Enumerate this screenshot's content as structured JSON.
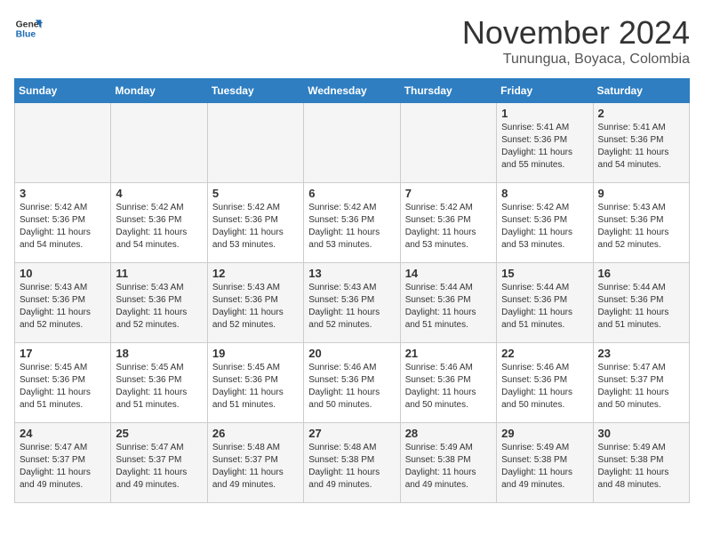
{
  "header": {
    "logo_general": "General",
    "logo_blue": "Blue",
    "month_title": "November 2024",
    "subtitle": "Tunungua, Boyaca, Colombia"
  },
  "days_of_week": [
    "Sunday",
    "Monday",
    "Tuesday",
    "Wednesday",
    "Thursday",
    "Friday",
    "Saturday"
  ],
  "weeks": [
    [
      {
        "day": "",
        "info": ""
      },
      {
        "day": "",
        "info": ""
      },
      {
        "day": "",
        "info": ""
      },
      {
        "day": "",
        "info": ""
      },
      {
        "day": "",
        "info": ""
      },
      {
        "day": "1",
        "info": "Sunrise: 5:41 AM\nSunset: 5:36 PM\nDaylight: 11 hours\nand 55 minutes."
      },
      {
        "day": "2",
        "info": "Sunrise: 5:41 AM\nSunset: 5:36 PM\nDaylight: 11 hours\nand 54 minutes."
      }
    ],
    [
      {
        "day": "3",
        "info": "Sunrise: 5:42 AM\nSunset: 5:36 PM\nDaylight: 11 hours\nand 54 minutes."
      },
      {
        "day": "4",
        "info": "Sunrise: 5:42 AM\nSunset: 5:36 PM\nDaylight: 11 hours\nand 54 minutes."
      },
      {
        "day": "5",
        "info": "Sunrise: 5:42 AM\nSunset: 5:36 PM\nDaylight: 11 hours\nand 53 minutes."
      },
      {
        "day": "6",
        "info": "Sunrise: 5:42 AM\nSunset: 5:36 PM\nDaylight: 11 hours\nand 53 minutes."
      },
      {
        "day": "7",
        "info": "Sunrise: 5:42 AM\nSunset: 5:36 PM\nDaylight: 11 hours\nand 53 minutes."
      },
      {
        "day": "8",
        "info": "Sunrise: 5:42 AM\nSunset: 5:36 PM\nDaylight: 11 hours\nand 53 minutes."
      },
      {
        "day": "9",
        "info": "Sunrise: 5:43 AM\nSunset: 5:36 PM\nDaylight: 11 hours\nand 52 minutes."
      }
    ],
    [
      {
        "day": "10",
        "info": "Sunrise: 5:43 AM\nSunset: 5:36 PM\nDaylight: 11 hours\nand 52 minutes."
      },
      {
        "day": "11",
        "info": "Sunrise: 5:43 AM\nSunset: 5:36 PM\nDaylight: 11 hours\nand 52 minutes."
      },
      {
        "day": "12",
        "info": "Sunrise: 5:43 AM\nSunset: 5:36 PM\nDaylight: 11 hours\nand 52 minutes."
      },
      {
        "day": "13",
        "info": "Sunrise: 5:43 AM\nSunset: 5:36 PM\nDaylight: 11 hours\nand 52 minutes."
      },
      {
        "day": "14",
        "info": "Sunrise: 5:44 AM\nSunset: 5:36 PM\nDaylight: 11 hours\nand 51 minutes."
      },
      {
        "day": "15",
        "info": "Sunrise: 5:44 AM\nSunset: 5:36 PM\nDaylight: 11 hours\nand 51 minutes."
      },
      {
        "day": "16",
        "info": "Sunrise: 5:44 AM\nSunset: 5:36 PM\nDaylight: 11 hours\nand 51 minutes."
      }
    ],
    [
      {
        "day": "17",
        "info": "Sunrise: 5:45 AM\nSunset: 5:36 PM\nDaylight: 11 hours\nand 51 minutes."
      },
      {
        "day": "18",
        "info": "Sunrise: 5:45 AM\nSunset: 5:36 PM\nDaylight: 11 hours\nand 51 minutes."
      },
      {
        "day": "19",
        "info": "Sunrise: 5:45 AM\nSunset: 5:36 PM\nDaylight: 11 hours\nand 51 minutes."
      },
      {
        "day": "20",
        "info": "Sunrise: 5:46 AM\nSunset: 5:36 PM\nDaylight: 11 hours\nand 50 minutes."
      },
      {
        "day": "21",
        "info": "Sunrise: 5:46 AM\nSunset: 5:36 PM\nDaylight: 11 hours\nand 50 minutes."
      },
      {
        "day": "22",
        "info": "Sunrise: 5:46 AM\nSunset: 5:36 PM\nDaylight: 11 hours\nand 50 minutes."
      },
      {
        "day": "23",
        "info": "Sunrise: 5:47 AM\nSunset: 5:37 PM\nDaylight: 11 hours\nand 50 minutes."
      }
    ],
    [
      {
        "day": "24",
        "info": "Sunrise: 5:47 AM\nSunset: 5:37 PM\nDaylight: 11 hours\nand 49 minutes."
      },
      {
        "day": "25",
        "info": "Sunrise: 5:47 AM\nSunset: 5:37 PM\nDaylight: 11 hours\nand 49 minutes."
      },
      {
        "day": "26",
        "info": "Sunrise: 5:48 AM\nSunset: 5:37 PM\nDaylight: 11 hours\nand 49 minutes."
      },
      {
        "day": "27",
        "info": "Sunrise: 5:48 AM\nSunset: 5:38 PM\nDaylight: 11 hours\nand 49 minutes."
      },
      {
        "day": "28",
        "info": "Sunrise: 5:49 AM\nSunset: 5:38 PM\nDaylight: 11 hours\nand 49 minutes."
      },
      {
        "day": "29",
        "info": "Sunrise: 5:49 AM\nSunset: 5:38 PM\nDaylight: 11 hours\nand 49 minutes."
      },
      {
        "day": "30",
        "info": "Sunrise: 5:49 AM\nSunset: 5:38 PM\nDaylight: 11 hours\nand 48 minutes."
      }
    ]
  ]
}
